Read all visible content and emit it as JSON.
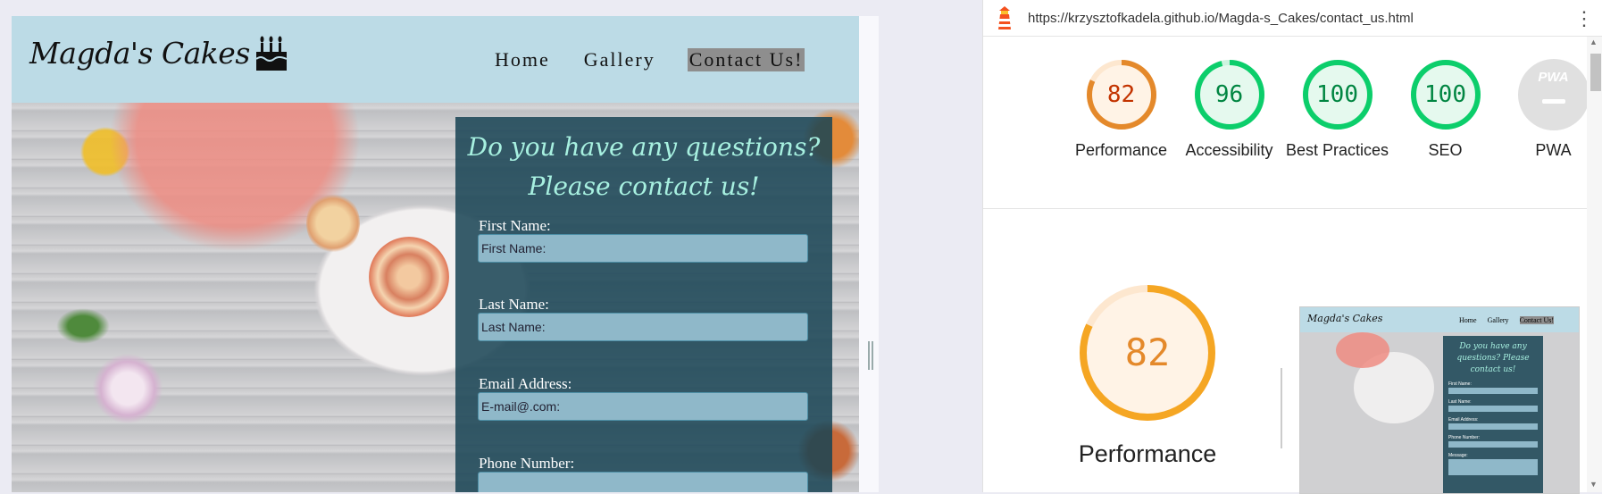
{
  "site": {
    "logo": "Magda's Cakes",
    "nav": [
      "Home",
      "Gallery",
      "Contact Us!"
    ],
    "active_nav": "Contact Us!",
    "contact": {
      "title": "Do you have any questions? Please contact us!",
      "fields": [
        {
          "label": "First Name:",
          "placeholder": "First Name:"
        },
        {
          "label": "Last Name:",
          "placeholder": "Last Name:"
        },
        {
          "label": "Email Address:",
          "placeholder": "E-mail@.com:"
        },
        {
          "label": "Phone Number:",
          "placeholder": ""
        }
      ]
    },
    "colors": {
      "header_bg": "#bcdbe6",
      "panel_bg": "#184454",
      "title_color": "#a7f0e0"
    }
  },
  "lighthouse": {
    "url": "https://krzysztofkadela.github.io/Magda-s_Cakes/contact_us.html",
    "scores": [
      {
        "label": "Performance",
        "value": "82",
        "score": 82,
        "color": "#e4892b"
      },
      {
        "label": "Accessibility",
        "value": "96",
        "score": 96,
        "color": "#0cce6b"
      },
      {
        "label": "Best Practices",
        "value": "100",
        "score": 100,
        "color": "#0cce6b"
      },
      {
        "label": "SEO",
        "value": "100",
        "score": 100,
        "color": "#0cce6b"
      },
      {
        "label": "PWA",
        "value": "PWA",
        "score": null,
        "color": "#cccccc"
      }
    ],
    "main": {
      "label": "Performance",
      "value": "82",
      "score": 82
    },
    "thumbnail": {
      "logo": "Magda's Cakes",
      "nav": [
        "Home",
        "Gallery",
        "Contact Us!"
      ],
      "title": "Do you have any questions? Please contact us!",
      "fields": [
        "First Name:",
        "Last Name:",
        "Email Address:",
        "Phone Number:",
        "Message:"
      ]
    }
  }
}
